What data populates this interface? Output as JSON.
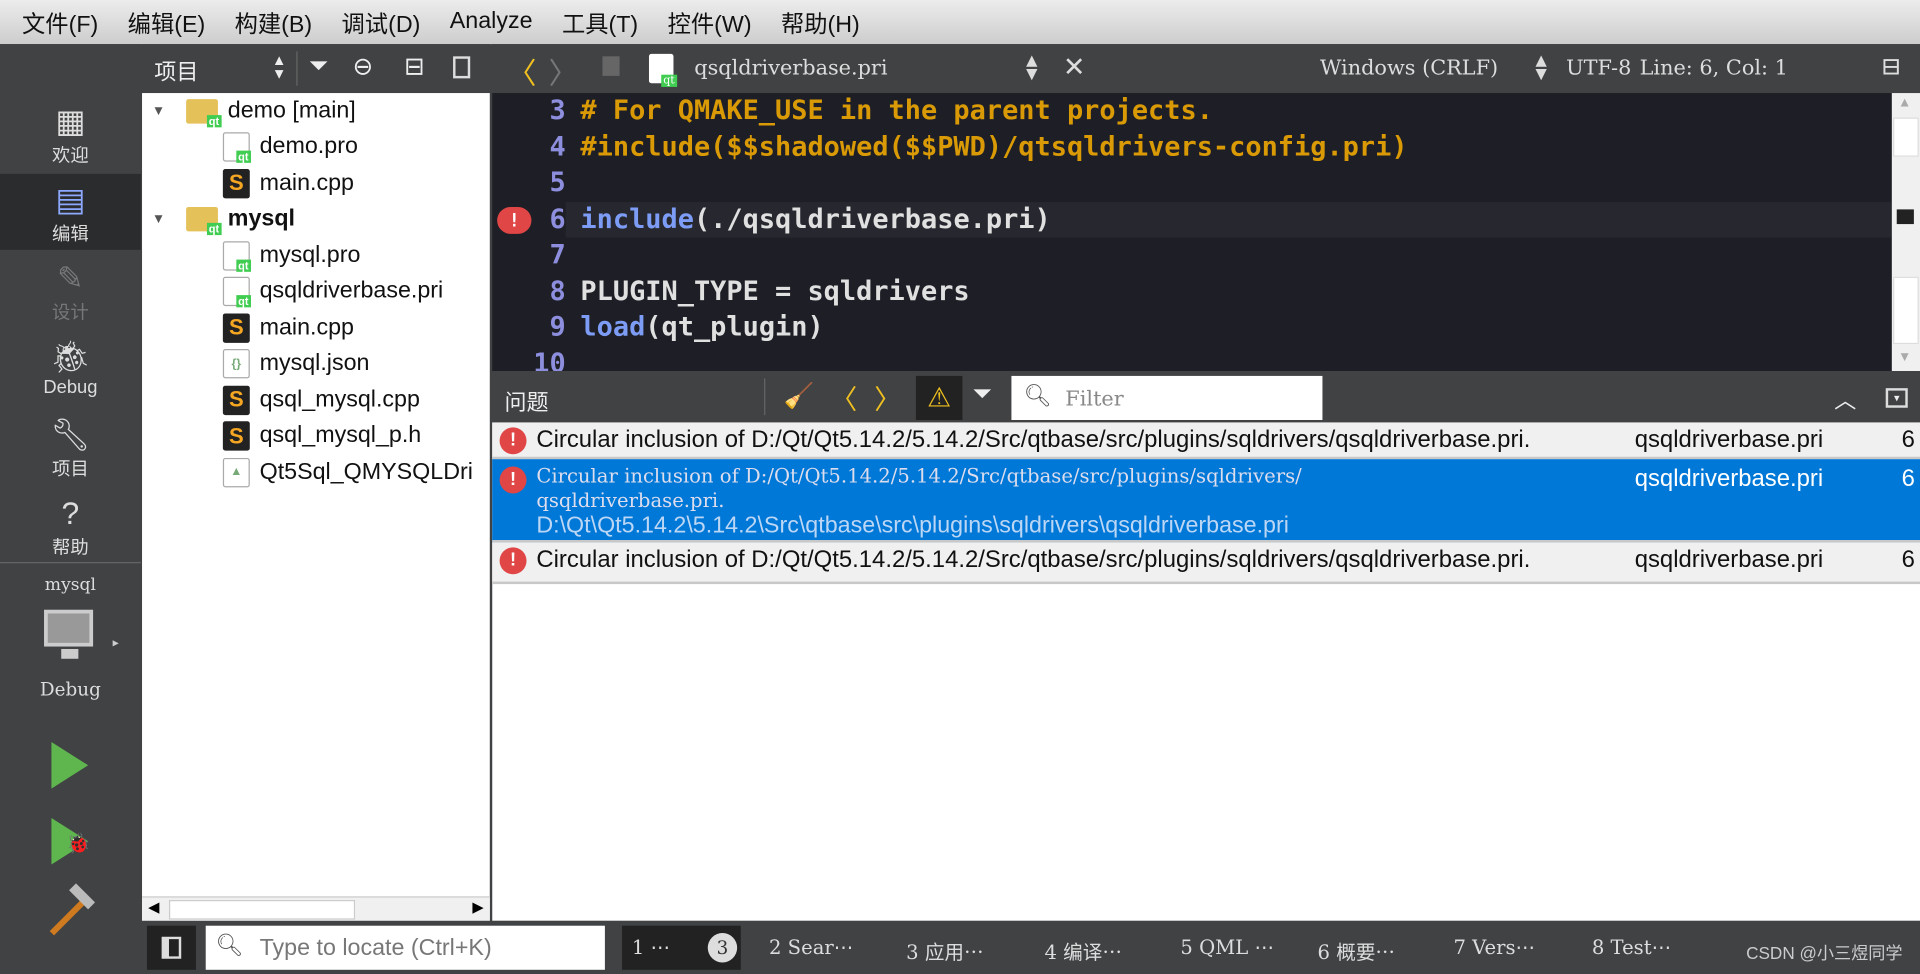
{
  "menu": [
    "文件(F)",
    "编辑(E)",
    "构建(B)",
    "调试(D)",
    "Analyze",
    "工具(T)",
    "控件(W)",
    "帮助(H)"
  ],
  "modes": [
    {
      "label": "欢迎",
      "icon": "grid-icon"
    },
    {
      "label": "编辑",
      "icon": "edit-icon"
    },
    {
      "label": "设计",
      "icon": "pencil-icon"
    },
    {
      "label": "Debug",
      "icon": "bug-icon"
    },
    {
      "label": "项目",
      "icon": "wrench-icon"
    },
    {
      "label": "帮助",
      "icon": "help-icon"
    }
  ],
  "target": {
    "project": "mysql",
    "config": "Debug"
  },
  "project_panel": {
    "title": "项目"
  },
  "tree": [
    {
      "label": "demo [main]",
      "type": "fold",
      "depth": 0,
      "bold": false
    },
    {
      "label": "demo.pro",
      "type": "pro",
      "depth": 1
    },
    {
      "label": "main.cpp",
      "type": "cpp",
      "depth": 1
    },
    {
      "label": "mysql",
      "type": "fold",
      "depth": 0,
      "bold": true
    },
    {
      "label": "mysql.pro",
      "type": "pro",
      "depth": 1
    },
    {
      "label": "qsqldriverbase.pri",
      "type": "pro",
      "depth": 1
    },
    {
      "label": "main.cpp",
      "type": "cpp",
      "depth": 1
    },
    {
      "label": "mysql.json",
      "type": "json",
      "depth": 1
    },
    {
      "label": "qsql_mysql.cpp",
      "type": "cpp",
      "depth": 1
    },
    {
      "label": "qsql_mysql_p.h",
      "type": "cpp",
      "depth": 1
    },
    {
      "label": "Qt5Sql_QMYSQLDri",
      "type": "cmake",
      "depth": 1
    }
  ],
  "editor": {
    "file": "qsqldriverbase.pri",
    "line_ending": "Windows (CRLF)",
    "encoding": "UTF-8",
    "position": "Line: 6, Col: 1",
    "lines": [
      {
        "n": "3",
        "parts": [
          {
            "t": "# For QMAKE_USE in the parent projects.",
            "c": "cmt"
          }
        ]
      },
      {
        "n": "4",
        "parts": [
          {
            "t": "#include($$shadowed($$PWD)/qtsqldrivers-config.pri)",
            "c": "cmt"
          }
        ]
      },
      {
        "n": "5",
        "parts": []
      },
      {
        "n": "6",
        "parts": [
          {
            "t": "include",
            "c": "kw"
          },
          {
            "t": "(./qsqldriverbase.pri)",
            "c": ""
          }
        ],
        "error": true
      },
      {
        "n": "7",
        "parts": []
      },
      {
        "n": "8",
        "parts": [
          {
            "t": "PLUGIN_TYPE = sqldrivers",
            "c": ""
          }
        ]
      },
      {
        "n": "9",
        "parts": [
          {
            "t": "load",
            "c": "kw"
          },
          {
            "t": "(qt_plugin)",
            "c": ""
          }
        ]
      },
      {
        "n": "10",
        "parts": []
      }
    ]
  },
  "issues": {
    "title": "问题",
    "filter_placeholder": "Filter",
    "rows": [
      {
        "text": "Circular inclusion of D:/Qt/Qt5.14.2/5.14.2/Src/qtbase/src/plugins/sqldrivers/qsqldriverbase.pri.",
        "file": "qsqldriverbase.pri",
        "line": "6"
      },
      {
        "text": "Circular inclusion of D:/Qt/Qt5.14.2/5.14.2/Src/qtbase/src/plugins/sqldrivers/",
        "text2": "qsqldriverbase.pri.",
        "path": "D:\\Qt\\Qt5.14.2\\5.14.2\\Src\\qtbase\\src\\plugins\\sqldrivers\\qsqldriverbase.pri",
        "file": "qsqldriverbase.pri",
        "line": "6",
        "selected": true
      },
      {
        "text": "Circular inclusion of D:/Qt/Qt5.14.2/5.14.2/Src/qtbase/src/plugins/sqldrivers/qsqldriverbase.pri.",
        "file": "qsqldriverbase.pri",
        "line": "6"
      }
    ]
  },
  "bottom": {
    "locator_placeholder": "Type to locate (Ctrl+K)",
    "badge": "3",
    "panes": [
      "1 ⋯",
      "2 Sear⋯",
      "3 应用⋯",
      "4 编译⋯",
      "5 QML ⋯",
      "6 概要⋯",
      "7 Vers⋯",
      "8 Test⋯"
    ],
    "watermark": "CSDN @小三煜同学"
  },
  "colors": {
    "selection": "#0078d7",
    "error": "#e04646",
    "comment": "#d99a06",
    "keyword": "#7c9cf5"
  }
}
